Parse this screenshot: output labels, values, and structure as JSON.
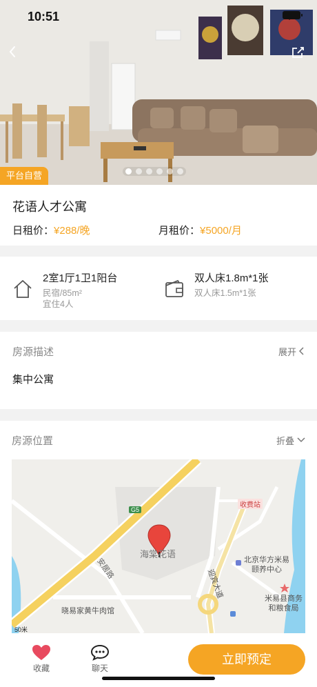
{
  "status": {
    "time": "10:51"
  },
  "hero": {
    "badge": "平台自营",
    "slide_count": 6,
    "active_slide": 0
  },
  "listing": {
    "title": "花语人才公寓",
    "daily_label": "日租价：",
    "daily_price": "¥288/晚",
    "monthly_label": "月租价：",
    "monthly_price": "¥5000/月"
  },
  "room": {
    "layout_main": "2室1厅1卫1阳台",
    "layout_sub": "民宿/85m²",
    "layout_sub2": "宜住4人",
    "bed_main": "双人床1.8m*1张",
    "bed_sub": "双人床1.5m*1张"
  },
  "description": {
    "title": "房源描述",
    "action": "展开",
    "text": "集中公寓"
  },
  "location": {
    "title": "房源位置",
    "action": "折叠"
  },
  "map": {
    "poi_center": "海棠花语",
    "road_label": "安居路",
    "highway_badge": "G5",
    "toll_label": "收费站",
    "poi_center_right": "北京华方米易",
    "poi_center_right2": "颐养中心",
    "poi_bureau": "米易县商务",
    "poi_bureau2": "和粮食局",
    "avenue_label": "迎宾大道",
    "restaurant": "晓易家黄牛肉馆",
    "scale": "50米"
  },
  "bottom": {
    "favorite": "收藏",
    "chat": "聊天",
    "book": "立即预定"
  },
  "colors": {
    "accent": "#f5a524",
    "pin": "#e8453c"
  }
}
